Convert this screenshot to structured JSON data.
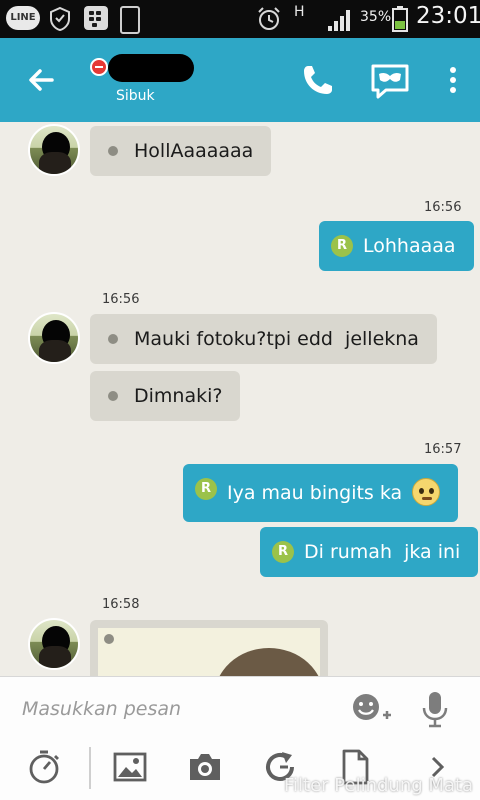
{
  "status_bar": {
    "line_label": "LINE",
    "network_label": "H",
    "battery_percent": "35%",
    "time": "23:01",
    "icons": [
      "line-app-icon",
      "shield-icon",
      "bbm-icon",
      "phone-icon",
      "alarm-icon",
      "signal-icon",
      "battery-icon"
    ]
  },
  "header": {
    "contact_status": "Sibuk",
    "accent_color": "#2ea7c6",
    "icons": [
      "back-arrow-icon",
      "minus-badge-icon",
      "phone-call-icon",
      "video-mask-icon",
      "more-vert-icon"
    ]
  },
  "messages": [
    {
      "direction": "incoming",
      "text": "HollAaaaaaa"
    },
    {
      "direction": "outgoing",
      "time": "16:56",
      "text": "Lohhaaaa"
    },
    {
      "direction": "incoming",
      "time": "16:56",
      "text": "Mauki fotoku?tpi edd  jellekna"
    },
    {
      "direction": "incoming",
      "text": "Dimnaki?"
    },
    {
      "direction": "outgoing",
      "time": "16:57",
      "text": "Iya mau bingits ka",
      "emoji": "pleading-face-icon"
    },
    {
      "direction": "outgoing",
      "text": "Di rumah  jka ini"
    },
    {
      "direction": "incoming",
      "time": "16:58",
      "type": "photo"
    }
  ],
  "read_marker": "R",
  "input": {
    "placeholder": "Masukkan pesan",
    "value": ""
  },
  "toolbar": {
    "icons": [
      "timer-icon",
      "image-icon",
      "camera-icon",
      "refresh-icon",
      "file-icon",
      "chevron-right-icon"
    ]
  },
  "overlay_caption": "Filter Pelindung Mata"
}
